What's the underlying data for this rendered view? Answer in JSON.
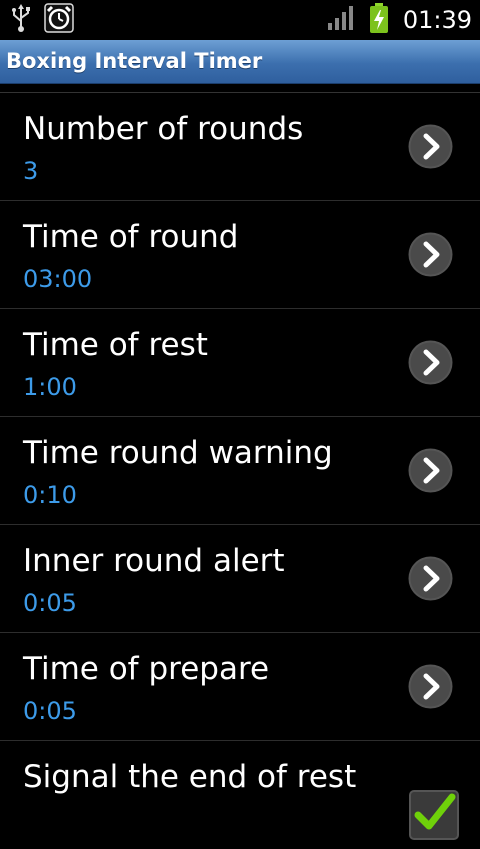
{
  "status_bar": {
    "time": "01:39",
    "icons": [
      "usb-icon",
      "alarm-clock-icon",
      "signal-icon",
      "battery-charging-icon"
    ]
  },
  "title_bar": {
    "title": "Boxing Interval Timer"
  },
  "preferences": [
    {
      "title": "Number of rounds",
      "summary": "3",
      "widget": "chevron-right-icon"
    },
    {
      "title": "Time of round",
      "summary": "03:00",
      "widget": "chevron-right-icon"
    },
    {
      "title": "Time of rest",
      "summary": "1:00",
      "widget": "chevron-right-icon"
    },
    {
      "title": "Time round warning",
      "summary": "0:10",
      "widget": "chevron-right-icon"
    },
    {
      "title": "Inner round alert",
      "summary": "0:05",
      "widget": "chevron-right-icon"
    },
    {
      "title": "Time of prepare",
      "summary": "0:05",
      "widget": "chevron-right-icon"
    },
    {
      "title": "Signal the end of rest",
      "summary": "",
      "widget": "checkbox",
      "checked": true
    }
  ],
  "colors": {
    "background": "#000000",
    "title_bar": "#3c6fae",
    "summary_text": "#3d9be9",
    "check_green": "#6fd10a"
  }
}
